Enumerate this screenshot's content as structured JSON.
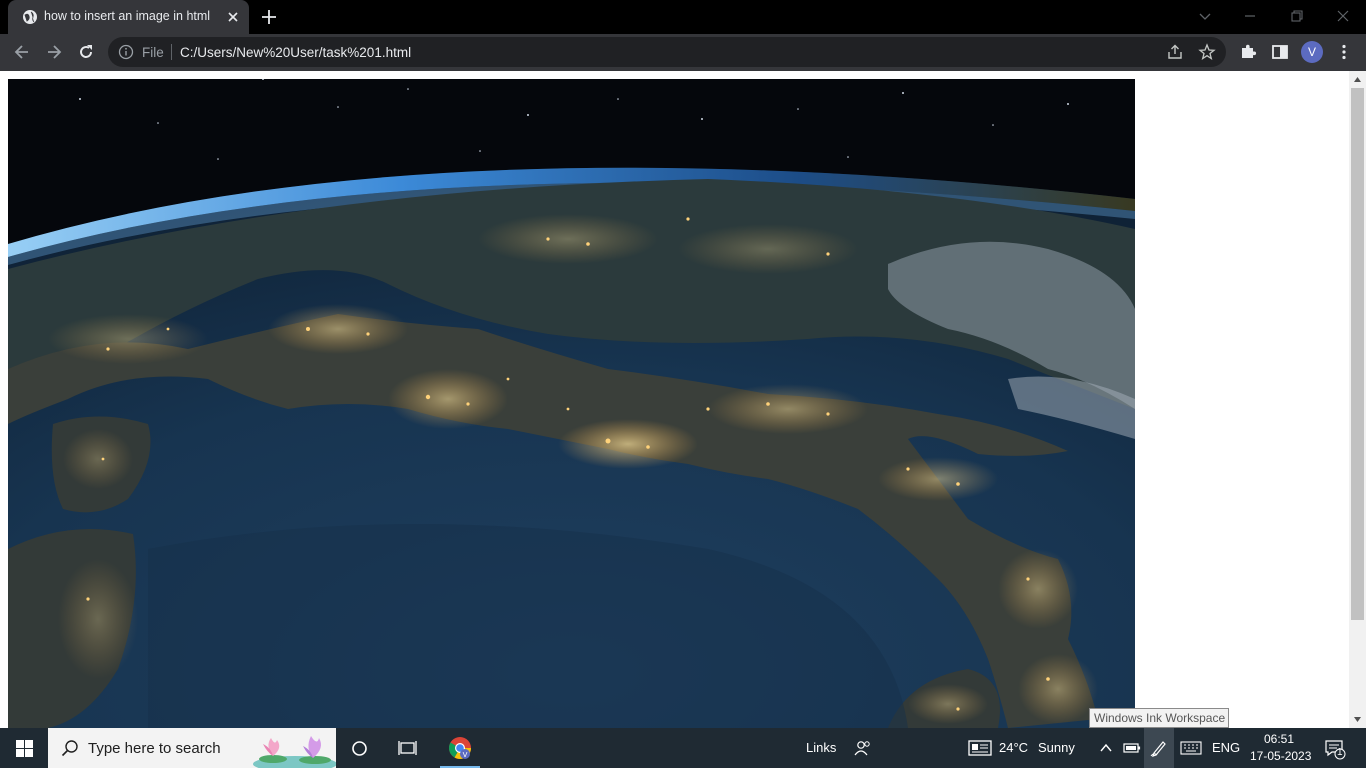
{
  "browser": {
    "tab_title": "how to insert an image in html",
    "omnibox_scheme": "File",
    "omnibox_url": "C:/Users/New%20User/task%201.html",
    "profile_initial": "V"
  },
  "page": {
    "image_description": "earth-at-night-italy"
  },
  "tooltip": {
    "text": "Windows Ink Workspace"
  },
  "taskbar": {
    "search_placeholder": "Type here to search",
    "links_label": "Links",
    "weather_temp": "24°C",
    "weather_condition": "Sunny",
    "language": "ENG",
    "time": "06:51",
    "date": "17-05-2023",
    "notification_count": "1"
  },
  "colors": {
    "tab_strip": "#000000",
    "toolbar": "#35363a",
    "omnibox": "#202124",
    "taskbar": "#1f2a33",
    "accent": "#76b9ed"
  }
}
